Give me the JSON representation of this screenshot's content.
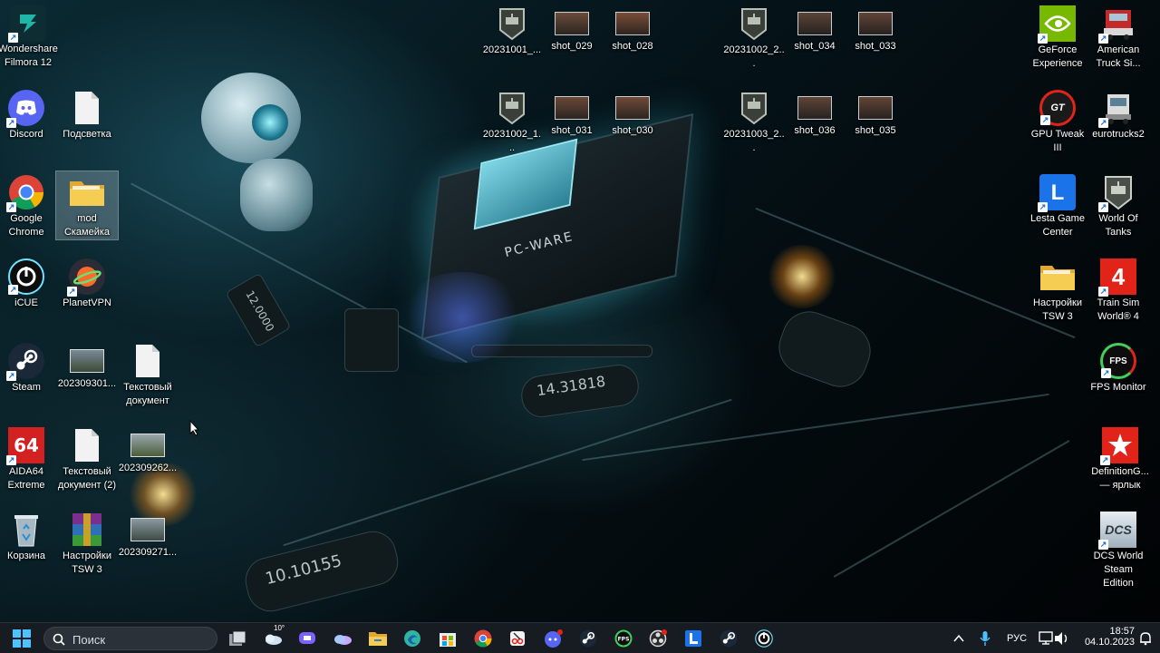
{
  "desktop": {
    "icons_left": [
      {
        "id": "filmora",
        "label": "Wondershare Filmora 12",
        "icon": "filmora-icon",
        "color": "#1fb6a8"
      },
      {
        "id": "discord",
        "label": "Discord",
        "icon": "discord-icon",
        "color": "#5865f2"
      },
      {
        "id": "podsvetka",
        "label": "Подсветка",
        "icon": "blank-file-icon"
      },
      {
        "id": "chrome",
        "label": "Google Chrome",
        "icon": "chrome-icon"
      },
      {
        "id": "mod",
        "label": "mod Скамейка",
        "icon": "folder-icon",
        "color": "#f4c542"
      },
      {
        "id": "icue",
        "label": "iCUE",
        "icon": "icue-icon"
      },
      {
        "id": "planetvpn",
        "label": "PlanetVPN",
        "icon": "planetvpn-icon"
      },
      {
        "id": "steam",
        "label": "Steam",
        "icon": "steam-icon"
      },
      {
        "id": "img20230930",
        "label": "202309301...",
        "icon": "image-thumb-icon"
      },
      {
        "id": "textdoc",
        "label": "Текстовый документ",
        "icon": "blank-file-icon"
      },
      {
        "id": "aida64",
        "label": "AIDA64 Extreme",
        "icon": "aida64-icon",
        "color": "#d32020"
      },
      {
        "id": "textdoc2",
        "label": "Текстовый документ (2)",
        "icon": "blank-file-icon"
      },
      {
        "id": "img20230926",
        "label": "202309262...",
        "icon": "image-thumb-icon"
      },
      {
        "id": "recycle",
        "label": "Корзина",
        "icon": "recycle-bin-icon"
      },
      {
        "id": "tsw3_rar",
        "label": "Настройки TSW 3",
        "icon": "winrar-icon"
      },
      {
        "id": "img20230927",
        "label": "202309271...",
        "icon": "image-thumb-icon"
      }
    ],
    "icons_top": [
      {
        "id": "wot1",
        "label": "20231001_...",
        "icon": "wot-replay-icon"
      },
      {
        "id": "shot029",
        "label": "shot_029",
        "icon": "screenshot-thumb-icon"
      },
      {
        "id": "shot028",
        "label": "shot_028",
        "icon": "screenshot-thumb-icon"
      },
      {
        "id": "wot2",
        "label": "20231002_2...",
        "icon": "wot-replay-icon"
      },
      {
        "id": "shot034",
        "label": "shot_034",
        "icon": "screenshot-thumb-icon"
      },
      {
        "id": "shot033",
        "label": "shot_033",
        "icon": "screenshot-thumb-icon"
      },
      {
        "id": "wot3",
        "label": "20231002_1...",
        "icon": "wot-replay-icon"
      },
      {
        "id": "shot031",
        "label": "shot_031",
        "icon": "screenshot-thumb-icon"
      },
      {
        "id": "shot030",
        "label": "shot_030",
        "icon": "screenshot-thumb-icon"
      },
      {
        "id": "wot4",
        "label": "20231003_2...",
        "icon": "wot-replay-icon"
      },
      {
        "id": "shot036",
        "label": "shot_036",
        "icon": "screenshot-thumb-icon"
      },
      {
        "id": "shot035",
        "label": "shot_035",
        "icon": "screenshot-thumb-icon"
      }
    ],
    "icons_right": [
      {
        "id": "geforce",
        "label": "GeForce Experience",
        "icon": "nvidia-icon",
        "color": "#76b900"
      },
      {
        "id": "ats",
        "label": "American Truck Si...",
        "icon": "ats-truck-icon"
      },
      {
        "id": "gputweak",
        "label": "GPU Tweak III",
        "icon": "gpu-tweak-icon"
      },
      {
        "id": "eurotrucks2",
        "label": "eurotrucks2",
        "icon": "ets2-truck-icon"
      },
      {
        "id": "lesta",
        "label": "Lesta Game Center",
        "icon": "lesta-icon",
        "color": "#1a73e8"
      },
      {
        "id": "wot",
        "label": "World Of Tanks",
        "icon": "wot-icon"
      },
      {
        "id": "tsw3_folder",
        "label": "Настройки TSW 3",
        "icon": "folder-icon",
        "color": "#f4c542"
      },
      {
        "id": "trainsim",
        "label": "Train Sim World® 4",
        "icon": "train-sim-icon",
        "color": "#e2231a"
      },
      {
        "id": "fpsmonitor",
        "label": "FPS Monitor",
        "icon": "fps-monitor-icon"
      },
      {
        "id": "definition",
        "label": "DefinitionG... — ярлык",
        "icon": "definition-icon",
        "color": "#e2231a"
      },
      {
        "id": "dcs",
        "label": "DCS World Steam Edition",
        "icon": "dcs-icon"
      }
    ],
    "wallpaper_labels": {
      "chip": "PC-WARE",
      "crystal1": "14.31818",
      "crystal2": "10.10155",
      "crystal3": "12.0000"
    }
  },
  "taskbar": {
    "search_placeholder": "Поиск",
    "weather_temp": "10°",
    "pinned": [
      {
        "id": "task-view",
        "icon": "task-view-icon"
      },
      {
        "id": "weather",
        "icon": "weather-icon"
      },
      {
        "id": "meet",
        "icon": "meet-icon",
        "color": "#7b61ff"
      },
      {
        "id": "onedrive",
        "icon": "onedrive-icon",
        "color": "#c7a7ff"
      },
      {
        "id": "explorer",
        "icon": "file-explorer-icon",
        "color": "#f4c542"
      },
      {
        "id": "edge",
        "icon": "edge-icon",
        "color": "#2fb5a0"
      },
      {
        "id": "store",
        "icon": "ms-store-icon"
      },
      {
        "id": "chrome",
        "icon": "chrome-icon"
      },
      {
        "id": "snip",
        "icon": "snipping-tool-icon"
      },
      {
        "id": "discord",
        "icon": "discord-icon",
        "color": "#5865f2"
      },
      {
        "id": "steam",
        "icon": "steam-icon"
      },
      {
        "id": "fps",
        "icon": "fps-monitor-icon"
      },
      {
        "id": "obs",
        "icon": "obs-icon"
      },
      {
        "id": "lesta",
        "icon": "lesta-icon",
        "color": "#1a73e8"
      },
      {
        "id": "steam2",
        "icon": "steam-icon"
      },
      {
        "id": "icue",
        "icon": "icue-icon"
      }
    ],
    "tray": {
      "language": "РУС",
      "time": "18:57",
      "date": "04.10.2023"
    }
  }
}
